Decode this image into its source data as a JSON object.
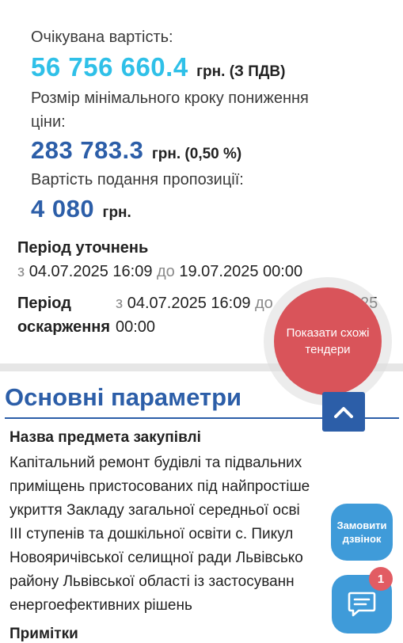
{
  "expected_value": {
    "label": "Очікувана вартість:",
    "amount": "56 756 660.4",
    "unit": "грн. (З ПДВ)"
  },
  "min_step": {
    "label_line1": "Розмір мінімального кроку пониження",
    "label_line2": "ціни:",
    "amount": "283 783.3",
    "unit": "грн. (0,50 %)"
  },
  "submission_cost": {
    "label": "Вартість подання пропозиції:",
    "amount": "4 080",
    "unit": "грн."
  },
  "clarification_period": {
    "title": "Період уточнень",
    "from_word": "з",
    "from": "04.07.2025 16:09",
    "to_word": "до",
    "to": "19.07.2025 00:00"
  },
  "appeal_period": {
    "title_line1": "Період",
    "title_line2": "оскарження",
    "from_word": "з",
    "from": "04.07.2025 16:09",
    "to_word": "до",
    "to_partial": "25",
    "to_time": "00:00"
  },
  "similar_tenders_button": "Показати схожі тендери",
  "main_params": {
    "title": "Основні параметри",
    "subject_label": "Назва предмета закупівлі",
    "subject_text": "Капітальний ремонт будівлі та підвальних\nприміщень пристосованих під найпростіше\nукриття Закладу загальної середньої осві\nІІІ ступенів та дошкільної освіти с. Пикул\nНовояричівської селищної ради Львівсько\nрайону Львівської області із застосуванн\nенергоефективних рішень",
    "next_label_partial": "Примітки"
  },
  "call_button": "Замовити дзвінок",
  "chat_badge_count": "1",
  "icons": {
    "up": "chevron-up-icon",
    "chat": "chat-icon"
  },
  "colors": {
    "cyan": "#2fc0e8",
    "blue": "#2c5ea8",
    "red": "#d9545a",
    "light_blue": "#3f9bd9"
  }
}
